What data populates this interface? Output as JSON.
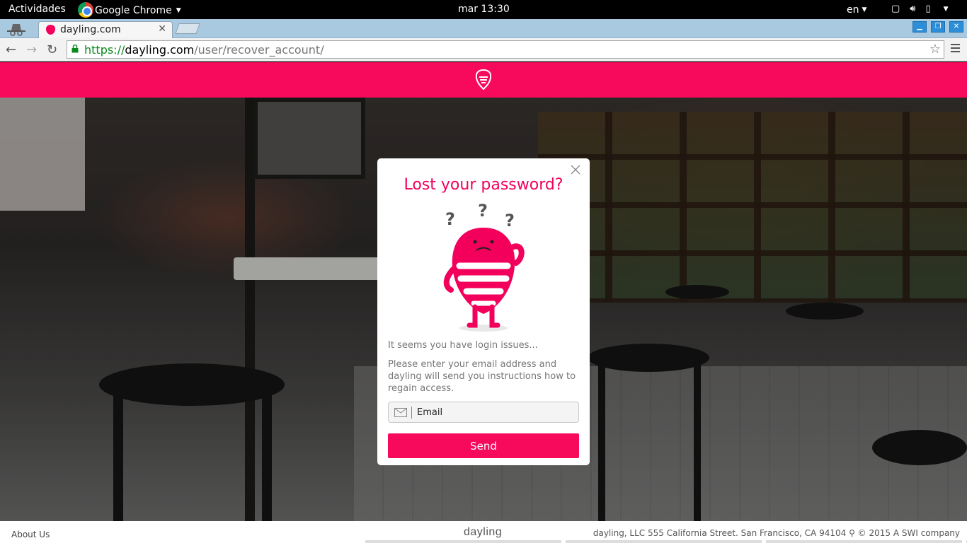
{
  "system_bar": {
    "activities": "Actividades",
    "app_name": "Google Chrome",
    "clock": "mar 13:30",
    "language": "en"
  },
  "browser": {
    "tab_title": "dayling.com",
    "url_scheme": "https://",
    "url_host": "dayling.com",
    "url_path": "/user/recover_account/"
  },
  "modal": {
    "title": "Lost your password?",
    "message1": "It seems you have login issues...",
    "message2": "Please enter your email address and dayling will send you instructions how to regain access.",
    "email_placeholder": "Email",
    "send_label": "Send"
  },
  "footer": {
    "about": "About Us",
    "brand": "dayling",
    "legal": "dayling, LLC 555 California Street. San Francisco, CA 94104 ⚲ © 2015 A SWI company"
  },
  "colors": {
    "brand_pink": "#f70a5b",
    "title_pink": "#f2005b"
  }
}
